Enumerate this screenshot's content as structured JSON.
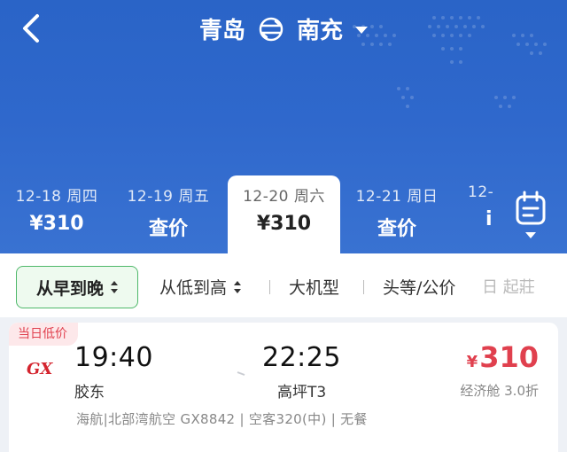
{
  "header": {
    "origin": "青岛",
    "destination": "南充"
  },
  "dates": [
    {
      "date": "12-18 周四",
      "price": "¥310"
    },
    {
      "date": "12-19 周五",
      "price": "查价"
    },
    {
      "date": "12-20 周六",
      "price": "¥310"
    },
    {
      "date": "12-21 周日",
      "price": "查价"
    },
    {
      "date": "12-",
      "price": "i"
    }
  ],
  "filters": {
    "active": "从早到晚",
    "items": [
      "从低到高",
      "大机型",
      "头等/公价",
      "日 起莊"
    ]
  },
  "flight": {
    "badge": "当日低价",
    "depart_time": "19:40",
    "depart_airport": "胶东",
    "arrive_time": "22:25",
    "arrive_airport": "高坪T3",
    "price_symbol": "¥",
    "price": "310",
    "cabin": "经济舱 3.0折",
    "meta": "海航|北部湾航空 GX8842 | 空客320(中) | 无餐"
  },
  "colors": {
    "hero_blue": "#2f68cc",
    "price_red": "#e0404e",
    "active_green": "#4fb86a"
  }
}
